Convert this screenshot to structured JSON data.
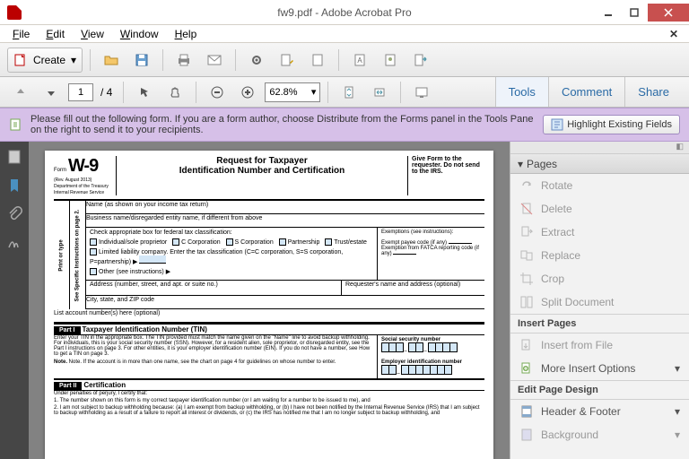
{
  "window": {
    "title": "fw9.pdf - Adobe Acrobat Pro"
  },
  "menu": {
    "file": "File",
    "edit": "Edit",
    "view": "View",
    "window": "Window",
    "help": "Help"
  },
  "toolbar": {
    "create": "Create"
  },
  "nav": {
    "page": "1",
    "pages": "/ 4",
    "zoom": "62.8%"
  },
  "panel_tabs": {
    "tools": "Tools",
    "comment": "Comment",
    "share": "Share"
  },
  "form_notice": {
    "msg": "Please fill out the following form. If you are a form author, choose Distribute from the Forms panel in the Tools Pane on the right to send it to your recipients.",
    "highlight": "Highlight Existing Fields"
  },
  "pages_panel": {
    "head": "Pages",
    "rotate": "Rotate",
    "delete": "Delete",
    "extract": "Extract",
    "replace": "Replace",
    "crop": "Crop",
    "split": "Split Document",
    "insert_head": "Insert Pages",
    "insert_file": "Insert from File",
    "more_insert": "More Insert Options",
    "edit_head": "Edit Page Design",
    "header_footer": "Header & Footer",
    "background": "Background"
  },
  "doc": {
    "form_word": "Form",
    "w9": "W-9",
    "rev": "(Rev. August 2013)",
    "dept": "Department of the Treasury",
    "irs": "Internal Revenue Service",
    "title1": "Request for Taxpayer",
    "title2": "Identification Number and Certification",
    "give": "Give Form to the requester. Do not send to the IRS.",
    "side_print": "Print or type",
    "side_specific": "See Specific Instructions on page 2.",
    "r1": "Name (as shown on your income tax return)",
    "r2": "Business name/disregarded entity name, if different from above",
    "r3_lead": "Check appropriate box for federal tax classification:",
    "c_ind": "Individual/sole proprietor",
    "c_c": "C Corporation",
    "c_s": "S Corporation",
    "c_p": "Partnership",
    "c_t": "Trust/estate",
    "c_llc": "Limited liability company. Enter the tax classification (C=C corporation, S=S corporation, P=partnership) ▶",
    "c_other": "Other (see instructions) ▶",
    "ex_head": "Exemptions (see instructions):",
    "ex_payee": "Exempt payee code (if any)",
    "ex_fatca": "Exemption from FATCA reporting code (if any)",
    "addr": "Address (number, street, and apt. or suite no.)",
    "req": "Requester's name and address (optional)",
    "city": "City, state, and ZIP code",
    "acct": "List account number(s) here (optional)",
    "part1": "Part I",
    "part1_t": "Taxpayer Identification Number (TIN)",
    "tin_text": "Enter your TIN in the appropriate box. The TIN provided must match the name given on the \"Name\" line to avoid backup withholding. For individuals, this is your social security number (SSN). However, for a resident alien, sole proprietor, or disregarded entity, see the Part I instructions on page 3. For other entities, it is your employer identification number (EIN). If you do not have a number, see How to get a TIN on page 3.",
    "tin_note": "Note. If the account is in more than one name, see the chart on page 4 for guidelines on whose number to enter.",
    "ssn_label": "Social security number",
    "ein_label": "Employer identification number",
    "part2": "Part II",
    "part2_t": "Certification",
    "pen": "Under penalties of perjury, I certify that:",
    "cert1": "1.  The number shown on this form is my correct taxpayer identification number (or I am waiting for a number to be issued to me), and",
    "cert2": "2.  I am not subject to backup withholding because: (a) I am exempt from backup withholding, or (b) I have not been notified by the Internal Revenue Service (IRS) that I am subject to backup withholding as a result of a failure to report all interest or dividends, or (c) the IRS has notified me that I am no longer subject to backup withholding, and"
  }
}
